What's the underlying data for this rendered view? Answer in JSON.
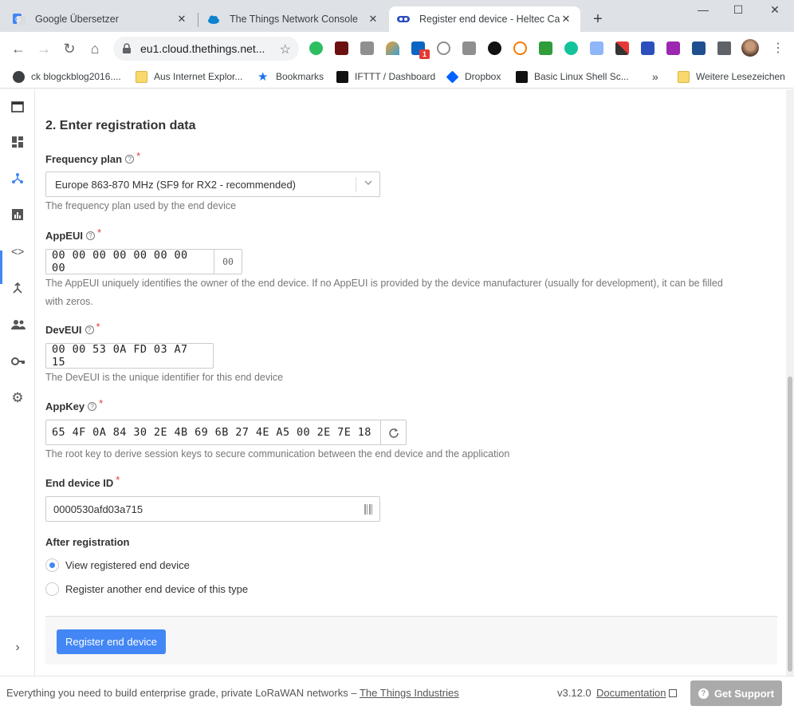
{
  "browser": {
    "tabs": [
      {
        "title": "Google Übersetzer",
        "icon": "google-translate-icon"
      },
      {
        "title": "The Things Network Console",
        "icon": "ttn-cloud-icon"
      },
      {
        "title": "Register end device - Heltec Capsule",
        "icon": "ttn-icon",
        "active": true
      }
    ],
    "url": "eu1.cloud.thethings.net...",
    "extension_badge": "1",
    "bookmarks": [
      {
        "label": "ck blogckblog2016....",
        "icon": "wordpress-icon"
      },
      {
        "label": "Aus Internet Explor...",
        "icon": "folder-icon"
      },
      {
        "label": "Bookmarks",
        "icon": "star-icon"
      },
      {
        "label": "IFTTT / Dashboard",
        "icon": "ifttt-icon"
      },
      {
        "label": "Dropbox",
        "icon": "dropbox-icon"
      },
      {
        "label": "Basic Linux Shell Sc...",
        "icon": "terminal-icon"
      },
      {
        "label": "Weitere Lesezeichen",
        "icon": "folder-icon"
      }
    ],
    "more_bookmarks": "»"
  },
  "form": {
    "section_title": "2. Enter registration data",
    "frequency_plan": {
      "label": "Frequency plan",
      "value": "Europe 863-870 MHz (SF9 for RX2 - recommended)",
      "description": "The frequency plan used by the end device"
    },
    "app_eui": {
      "label": "AppEUI",
      "value": "00 00 00 00 00 00 00 00",
      "addon": "00",
      "description_line1": "The AppEUI uniquely identifies the owner of the end device. If no AppEUI is provided by the device manufacturer (usually for development), it can be filled",
      "description_line2": "with zeros."
    },
    "dev_eui": {
      "label": "DevEUI",
      "value": "00 00 53 0A FD 03 A7 15",
      "description": "The DevEUI is the unique identifier for this end device"
    },
    "app_key": {
      "label": "AppKey",
      "value": "65 4F 0A 84 30 2E 4B 69 6B 27 4E A5 00 2E 7E 18",
      "description": "The root key to derive session keys to secure communication between the end device and the application"
    },
    "end_device_id": {
      "label": "End device ID",
      "value": "0000530afd03a715"
    },
    "after_registration": {
      "label": "After registration",
      "options": [
        {
          "label": "View registered end device",
          "checked": true
        },
        {
          "label": "Register another end device of this type",
          "checked": false
        }
      ]
    },
    "submit_label": "Register end device",
    "required_marker": "*",
    "help_marker": "?"
  },
  "footer": {
    "tagline": "Everything you need to build enterprise grade, private LoRaWAN networks – ",
    "tagline_link": "The Things Industries",
    "version": "v3.12.0",
    "docs_label": "Documentation",
    "support_label": "Get Support"
  },
  "colors": {
    "accent": "#4287f5",
    "required": "#e53935",
    "support_button": "#aaaaaa"
  }
}
